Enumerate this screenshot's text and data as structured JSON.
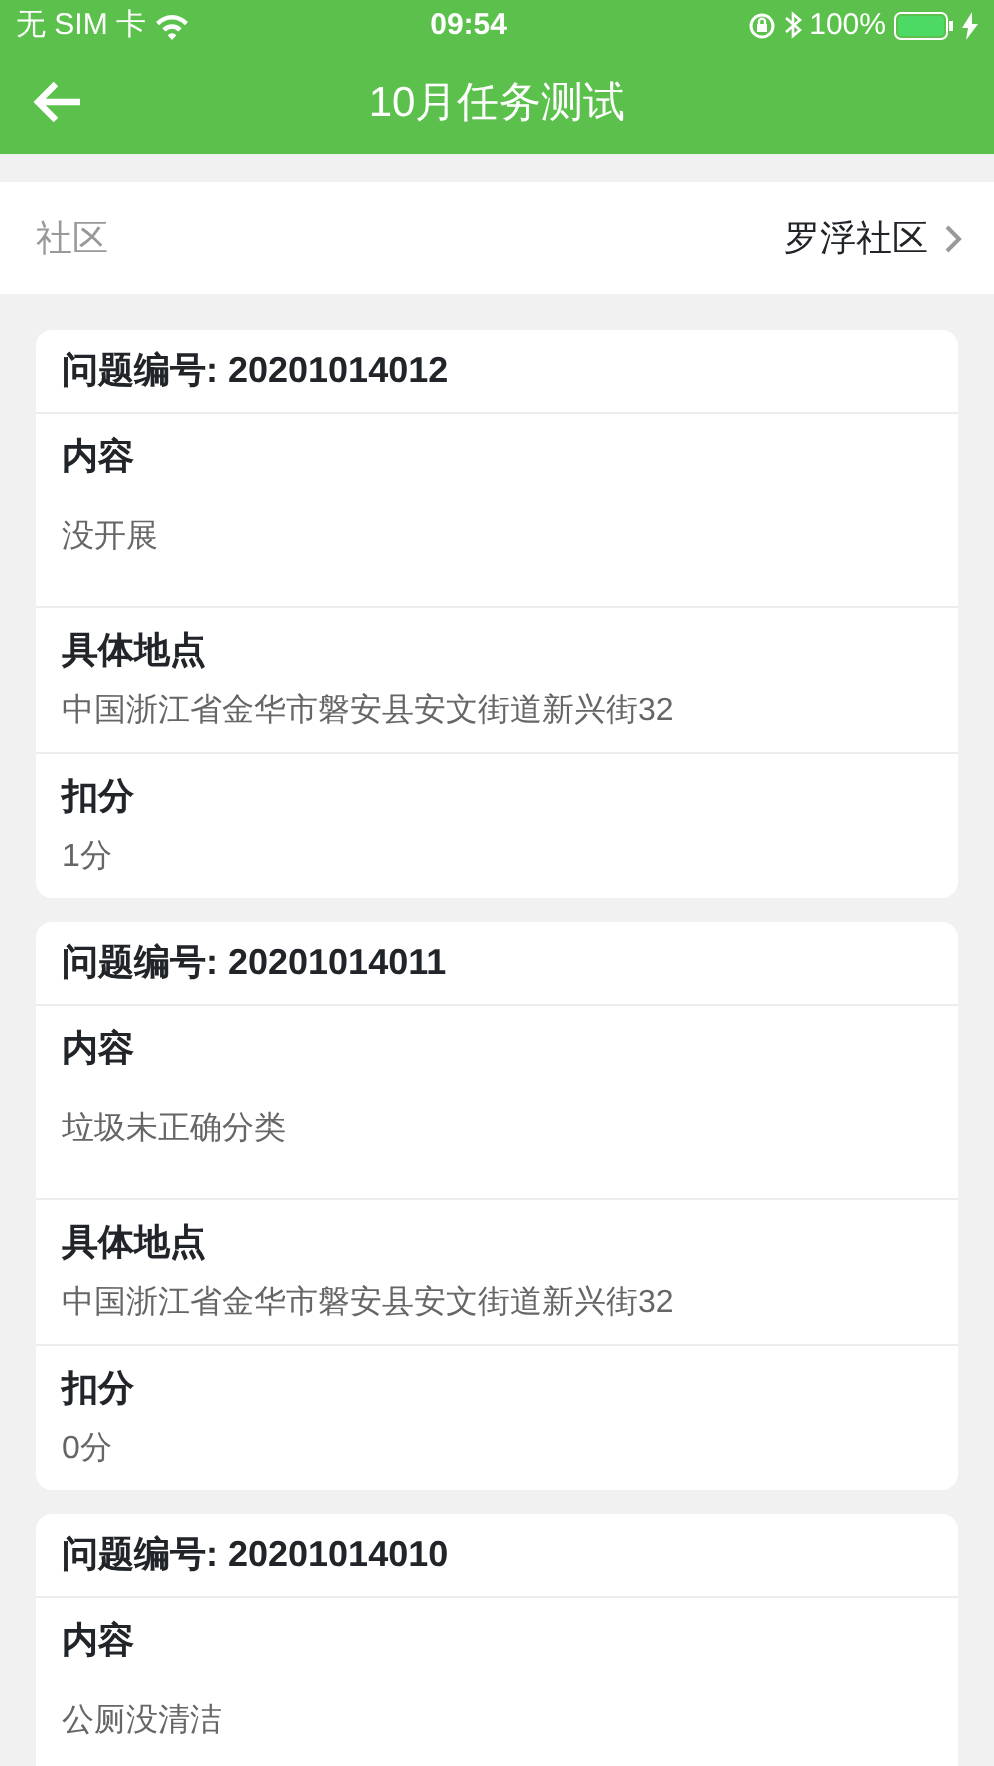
{
  "status_bar": {
    "carrier": "无 SIM 卡",
    "time": "09:54",
    "battery": "100%"
  },
  "header": {
    "title": "10月任务测试"
  },
  "community": {
    "label": "社区",
    "value": "罗浮社区"
  },
  "issues": [
    {
      "title": "问题编号: 20201014012",
      "fields": [
        {
          "kind": "spaced",
          "label": "内容",
          "value": "没开展"
        },
        {
          "kind": "compact",
          "label": "具体地点",
          "value": "中国浙江省金华市磐安县安文街道新兴街32"
        },
        {
          "kind": "compact",
          "label": "扣分",
          "value": "1分"
        }
      ]
    },
    {
      "title": "问题编号: 20201014011",
      "fields": [
        {
          "kind": "spaced",
          "label": "内容",
          "value": "垃圾未正确分类"
        },
        {
          "kind": "compact",
          "label": "具体地点",
          "value": "中国浙江省金华市磐安县安文街道新兴街32"
        },
        {
          "kind": "compact",
          "label": "扣分",
          "value": "0分"
        }
      ]
    },
    {
      "title": "问题编号: 20201014010",
      "fields": [
        {
          "kind": "spaced",
          "label": "内容",
          "value": "公厕没清洁"
        }
      ]
    }
  ]
}
